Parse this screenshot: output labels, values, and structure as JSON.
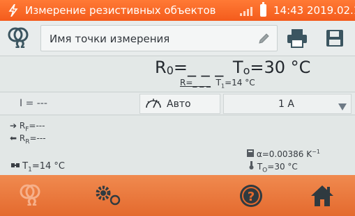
{
  "status_bar": {
    "title": "Измерение резистивных объектов",
    "clock": "14:43 2019.02.10"
  },
  "header": {
    "point_name_label": "Имя точки измерения"
  },
  "result": {
    "r0_label": "R",
    "r0_sub": "0",
    "r0_value": "=_ _ _",
    "t0_label": "T",
    "t0_sub": "o",
    "t0_value": "=30 °C",
    "r_label": "R=_ _ _",
    "t1_label": "T",
    "t1_sub": "1",
    "t1_value": "=14 °C"
  },
  "controls": {
    "current": "I = ---",
    "mode_label": "Авто",
    "amp_value": "1 A"
  },
  "info": {
    "rf_label": "R",
    "rf_sub": "F",
    "rf_value": "=---",
    "rr_label": "R",
    "rr_sub": "R",
    "rr_value": "=---",
    "t1_label": "T",
    "t1_sub": "1",
    "t1_value": "=14 °C",
    "alpha_text": "α=0.00386 K",
    "alpha_exp": "−1",
    "t0_label": "T",
    "t0_sub": "O",
    "t0_value": "=30 °C"
  },
  "colors": {
    "accent": "#f45b1c",
    "toolbar": "#e46a2e",
    "icon_dark": "#3b5560"
  },
  "icons": {
    "app": "flash-icon",
    "logo": "resistance-meter-icon",
    "edit": "pencil-icon",
    "print": "printer-icon",
    "save": "floppy-disk-icon",
    "mode": "gauge-auto-icon",
    "dropdown": "chevron-down-icon",
    "settings": "gears-icon",
    "help": "help-icon",
    "home": "home-icon"
  }
}
